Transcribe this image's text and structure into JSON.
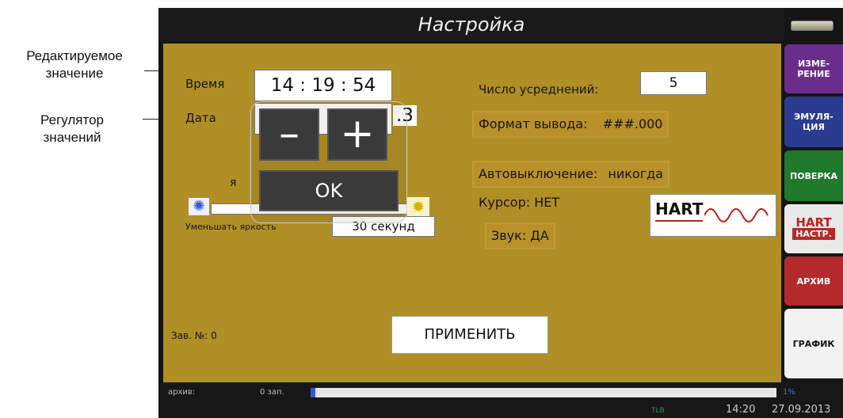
{
  "callouts": {
    "edited_value": [
      "Редактируемое",
      "значение"
    ],
    "value_regulator": [
      "Регулятор",
      "значений"
    ]
  },
  "screen": {
    "title": "Настройка",
    "time": {
      "label": "Время",
      "value": "14 : 19 : 54"
    },
    "date": {
      "label": "Дата",
      "value_visible": ".3"
    },
    "brightness": {
      "partial_label": "я"
    },
    "dim": {
      "label": "Уменьшать яркость",
      "value": "30 секунд"
    },
    "serial": "Зав. №: 0",
    "apply_label": "ПРИМЕНИТЬ",
    "averaging": {
      "label": "Число усреднений:",
      "value": "5"
    },
    "output_format": {
      "label": "Формат вывода:",
      "value": "###.000"
    },
    "auto_off": {
      "label": "Автовыключение:",
      "value": "никогда"
    },
    "cursor": "Курсор: НЕТ",
    "sound": "Звук: ДА",
    "hart_logo": "HART",
    "regulator": {
      "minus": "–",
      "plus": "+",
      "ok": "OK"
    },
    "side_menu": [
      {
        "lines": [
          "ИЗМЕ-",
          "РЕНИЕ"
        ],
        "color": "#6b2d8c"
      },
      {
        "lines": [
          "ЭМУЛЯ-",
          "ЦИЯ"
        ],
        "color": "#2b3b8f"
      },
      {
        "lines": [
          "ПОВЕРКА"
        ],
        "color": "#1f7a2c"
      },
      {
        "lines": [
          "HART",
          "НАСТР."
        ],
        "color": "#e9e9e9"
      },
      {
        "lines": [
          "АРХИВ"
        ],
        "color": "#b42a2a"
      },
      {
        "lines": [
          "ГРАФИК"
        ],
        "color": "#f2f2f2"
      }
    ],
    "status": {
      "archive_label": "архив:",
      "archive_count": "0 зап.",
      "archive_fill": 0.01,
      "percent": "1%",
      "bottom_mid": "TLB",
      "time": "14:20",
      "date": "27.09.2013"
    }
  }
}
